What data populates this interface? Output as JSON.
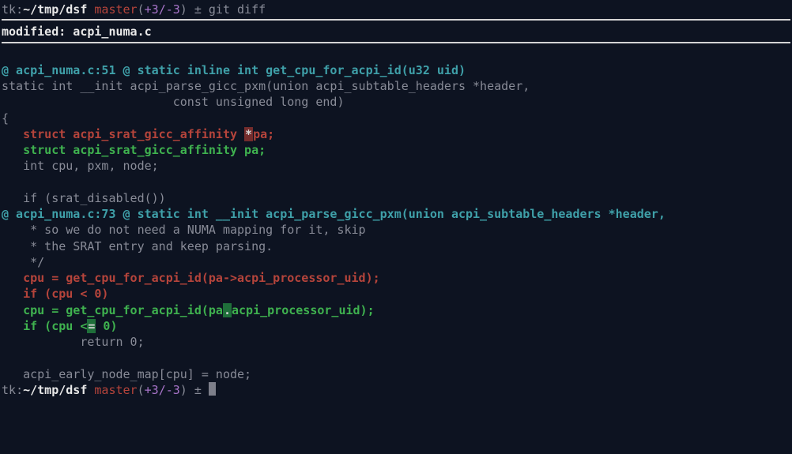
{
  "prompt": {
    "user": "tk",
    "sep_uh": ":",
    "home_tilde": "~",
    "cwd": "/tmp/dsf",
    "branch": "master",
    "counts_plus": "+3",
    "counts_sep": "/",
    "counts_minus": "-3",
    "pm": "±",
    "command": "git diff"
  },
  "diff": {
    "modified_header": "modified: acpi_numa.c",
    "hunk1": "@ acpi_numa.c:51 @ static inline int get_cpu_for_acpi_id(u32 uid)",
    "sig1": "static int __init acpi_parse_gicc_pxm(union acpi_subtable_headers *header,",
    "sig2": "                        const unsigned long end)",
    "brace_open": "{",
    "del_struct": "struct acpi_srat_gicc_affinity ",
    "del_struct_star": "*",
    "del_struct_tail": "pa;",
    "add_struct": "struct acpi_srat_gicc_affinity pa;",
    "ctx_decl": "int cpu, pxm, node;",
    "ctx_blank1": " ",
    "ctx_if_srat": "if (srat_disabled())",
    "hunk2": "@ acpi_numa.c:73 @ static int __init acpi_parse_gicc_pxm(union acpi_subtable_headers *header,",
    "c1": " * so we do not need a NUMA mapping for it, skip",
    "c2": " * the SRAT entry and keep parsing.",
    "c3": " */",
    "del_cpu_pre": "cpu = get_cpu_for_acpi_id(pa",
    "del_cpu_arrow": "->",
    "del_cpu_post": "acpi_processor_uid);",
    "del_if": "if (cpu < 0)",
    "add_cpu_pre": "cpu = get_cpu_for_acpi_id(pa",
    "add_cpu_dot": ".",
    "add_cpu_post": "acpi_processor_uid);",
    "add_if_pre": "if (cpu <",
    "add_if_eq": "=",
    "add_if_post": " 0)",
    "ctx_ret": "        return 0;",
    "ctx_blank2": " ",
    "ctx_map": "acpi_early_node_map[cpu] = node;"
  }
}
